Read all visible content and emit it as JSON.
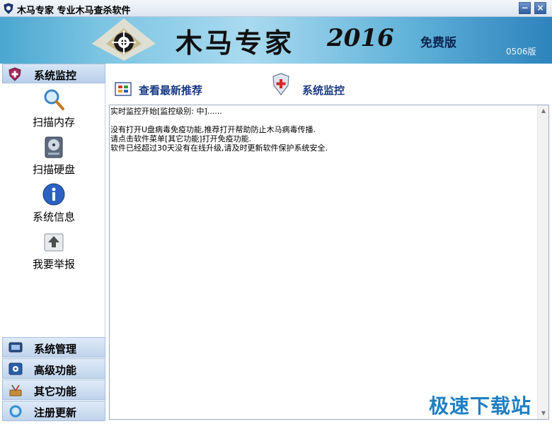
{
  "window": {
    "title": "木马专家  专业木马查杀软件",
    "minimize_label": "−",
    "close_label": "×"
  },
  "banner": {
    "title": "木马专家",
    "year": "2016",
    "edition": "免费版",
    "version": "0506版"
  },
  "sidebar": {
    "header": {
      "label": "系统监控",
      "icon": "shield-plus-icon"
    },
    "items": [
      {
        "label": "扫描内存",
        "icon": "magnifier-icon"
      },
      {
        "label": "扫描硬盘",
        "icon": "hard-disk-icon"
      },
      {
        "label": "系统信息",
        "icon": "info-icon"
      },
      {
        "label": "我要举报",
        "icon": "upload-report-icon"
      }
    ],
    "bottom_buttons": [
      {
        "label": "系统管理",
        "icon": "system-manage-icon"
      },
      {
        "label": "高级功能",
        "icon": "gear-icon"
      },
      {
        "label": "其它功能",
        "icon": "tools-icon"
      },
      {
        "label": "注册更新",
        "icon": "refresh-icon"
      }
    ]
  },
  "toolbar": {
    "recommend_label": "查看最新推荐",
    "monitor_label": "系统监控"
  },
  "log": {
    "lines": [
      "实时监控开始[监控级别: 中]......",
      "",
      "没有打开U盘病毒免疫功能,推荐打开帮助防止木马病毒传播.",
      "请点击软件菜单[其它功能]打开免疫功能.",
      "软件已经超过30天没有在线升级,请及时更新软件保护系统安全."
    ]
  },
  "watermark": "极速下载站",
  "colors": {
    "accent": "#1a3a86",
    "sidebar_button": "#c6d8ee",
    "banner": "#7cc4e2"
  }
}
